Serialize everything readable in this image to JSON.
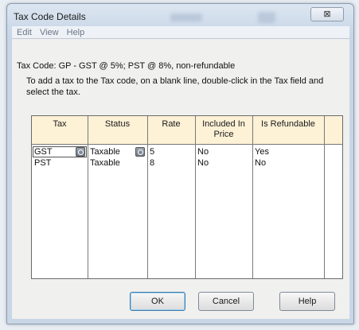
{
  "window": {
    "title": "Tax Code Details",
    "close_label": "⊠"
  },
  "menu": [
    "Edit",
    "View",
    "Help"
  ],
  "tax_code_line": "Tax Code: GP - GST @ 5%; PST @ 8%, non-refundable",
  "instructions": "To add a tax to the Tax code, on a blank line, double-click in the Tax field and select the tax.",
  "table": {
    "headers": [
      "Tax",
      "Status",
      "Rate",
      "Included In Price",
      "Is Refundable"
    ],
    "rows": [
      {
        "tax": "GST",
        "status": "Taxable",
        "rate": "5",
        "included": "No",
        "refundable": "Yes"
      },
      {
        "tax": "PST",
        "status": "Taxable",
        "rate": "8",
        "included": "No",
        "refundable": "No"
      }
    ]
  },
  "buttons": {
    "ok": "OK",
    "cancel": "Cancel",
    "help": "Help"
  }
}
